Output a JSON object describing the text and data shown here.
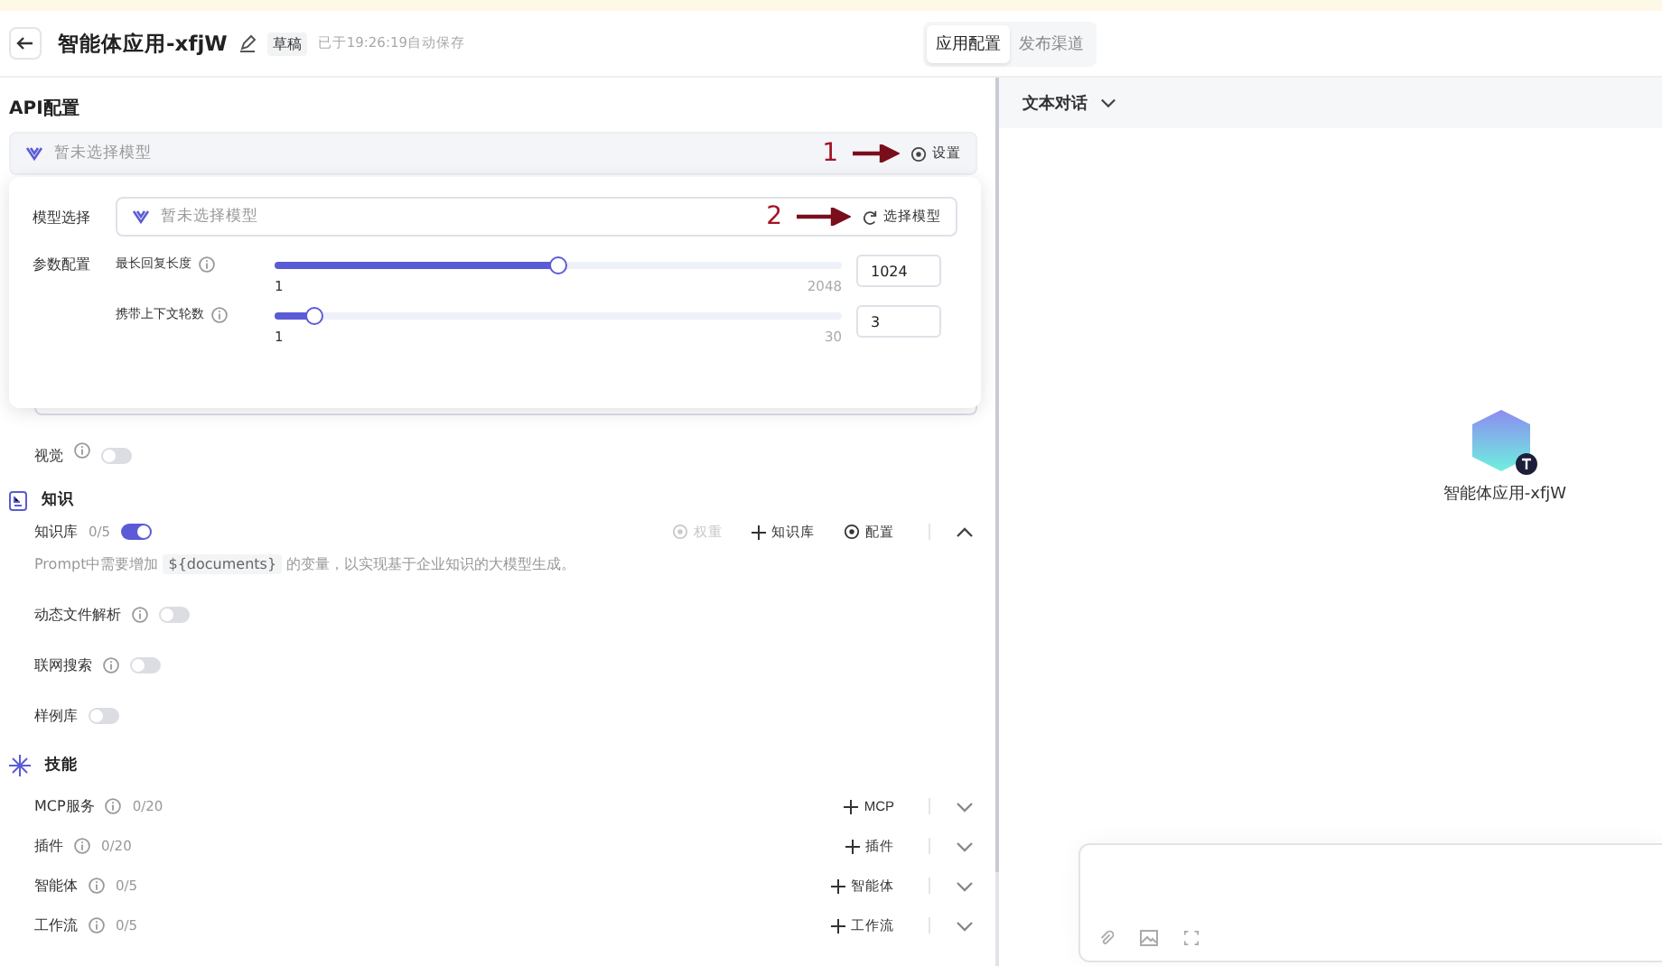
{
  "header": {
    "title": "智能体应用-xfjW",
    "tag": "草稿",
    "save_status": "已于19:26:19自动保存",
    "tabs": [
      {
        "label": "应用配置",
        "selected": true
      },
      {
        "label": "发布渠道",
        "selected": false
      }
    ]
  },
  "api_config": {
    "heading": "API配置",
    "model_placeholder": "暂未选择模型",
    "annotation": "1",
    "settings_button": "设置"
  },
  "popup": {
    "model_label": "模型选择",
    "model_placeholder": "暂未选择模型",
    "annotation": "2",
    "select_button": "选择模型",
    "params_label": "参数配置",
    "sliders": [
      {
        "label": "最长回复长度",
        "level": 0.5,
        "min": "1",
        "max": "2048",
        "value": "1024"
      },
      {
        "label": "携带上下文轮数",
        "level": 0.069,
        "min": "1",
        "max": "30",
        "value": "3"
      }
    ]
  },
  "vision": {
    "label": "视觉",
    "on": false
  },
  "knowledge": {
    "heading": "知识",
    "library": {
      "label": "知识库",
      "count": "0/5",
      "on": true
    },
    "actions": [
      {
        "label": "权重",
        "kind": "target",
        "disabled": true
      },
      {
        "label": "知识库",
        "kind": "add",
        "disabled": false
      },
      {
        "label": "配置",
        "kind": "target",
        "disabled": false
      }
    ],
    "hint_before": "Prompt中需要增加",
    "hint_code": "${documents}",
    "hint_after": "的变量，以实现基于企业知识的大模型生成。",
    "toggles": [
      {
        "label": "动态文件解析",
        "info": true,
        "on": false
      },
      {
        "label": "联网搜索",
        "info": true,
        "on": false
      },
      {
        "label": "样例库",
        "info": false,
        "on": false
      }
    ]
  },
  "skills": {
    "heading": "技能",
    "rows": [
      {
        "label": "MCP服务",
        "count": "0/20",
        "add": "MCP"
      },
      {
        "label": "插件",
        "count": "0/20",
        "add": "插件"
      },
      {
        "label": "智能体",
        "count": "0/5",
        "add": "智能体"
      },
      {
        "label": "工作流",
        "count": "0/5",
        "add": "工作流"
      }
    ]
  },
  "preview": {
    "mode": "文本对话",
    "agent_name": "智能体应用-xfjW"
  }
}
